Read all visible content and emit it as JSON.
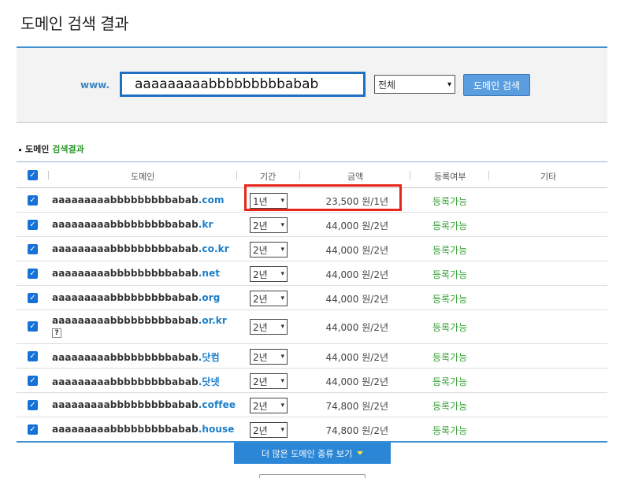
{
  "page_title": "도메인 검색 결과",
  "search": {
    "prefix": "www.",
    "query": "aaaaaaaaabbbbbbbbbabab",
    "tld_select": "전체",
    "button": "도메인 검색"
  },
  "section": {
    "prefix": "도메인",
    "highlight": "검색결과"
  },
  "headers": {
    "domain": "도메인",
    "period": "기간",
    "price": "금액",
    "status": "등록여부",
    "other": "기타"
  },
  "rows": [
    {
      "name": "aaaaaaaaabbbbbbbbbabab",
      "tld": ".com",
      "period": "1년",
      "price": "23,500 원/1년",
      "status": "등록가능"
    },
    {
      "name": "aaaaaaaaabbbbbbbbbabab",
      "tld": ".kr",
      "period": "2년",
      "price": "44,000 원/2년",
      "status": "등록가능"
    },
    {
      "name": "aaaaaaaaabbbbbbbbbabab",
      "tld": ".co.kr",
      "period": "2년",
      "price": "44,000 원/2년",
      "status": "등록가능"
    },
    {
      "name": "aaaaaaaaabbbbbbbbbabab",
      "tld": ".net",
      "period": "2년",
      "price": "44,000 원/2년",
      "status": "등록가능"
    },
    {
      "name": "aaaaaaaaabbbbbbbbbabab",
      "tld": ".org",
      "period": "2년",
      "price": "44,000 원/2년",
      "status": "등록가능"
    },
    {
      "name": "aaaaaaaaabbbbbbbbbabab",
      "tld": ".or.kr",
      "help": "?",
      "period": "2년",
      "price": "44,000 원/2년",
      "status": "등록가능"
    },
    {
      "name": "aaaaaaaaabbbbbbbbbabab",
      "tld": ".닷컴",
      "period": "2년",
      "price": "44,000 원/2년",
      "status": "등록가능"
    },
    {
      "name": "aaaaaaaaabbbbbbbbbabab",
      "tld": ".닷넷",
      "period": "2년",
      "price": "44,000 원/2년",
      "status": "등록가능"
    },
    {
      "name": "aaaaaaaaabbbbbbbbbabab",
      "tld": ".coffee",
      "period": "2년",
      "price": "74,800 원/2년",
      "status": "등록가능"
    },
    {
      "name": "aaaaaaaaabbbbbbbbbabab",
      "tld": ".house",
      "period": "2년",
      "price": "74,800 원/2년",
      "status": "등록가능"
    }
  ],
  "more_button": "더 많은 도메인 종류 보기",
  "colors": {
    "accent": "#3d8fd1",
    "tld": "#1c7ec9",
    "available": "#3aa33a",
    "highlight": "#e8261b",
    "checkbox": "#1672d6"
  }
}
